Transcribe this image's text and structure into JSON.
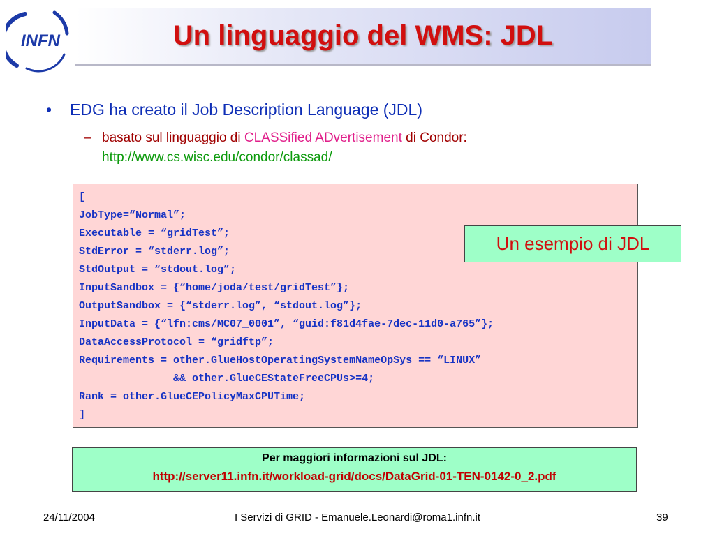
{
  "logo": {
    "text": "INFN"
  },
  "title": "Un linguaggio del WMS: JDL",
  "bullet": {
    "symbol": "•",
    "text": "EDG ha creato il Job Description Language (JDL)"
  },
  "sub_bullet": {
    "symbol": "–",
    "part1": "basato sul linguaggio di ",
    "part2": "CLASSified ADvertisement",
    "part3": " di Condor:",
    "url": "http://www.cs.wisc.edu/condor/classad/"
  },
  "code_lines": [
    "[",
    "JobType=“Normal”;",
    "Executable = “gridTest”;",
    "StdError = “stderr.log”;",
    "StdOutput = “stdout.log”;",
    "InputSandbox = {“home/joda/test/gridTest”};",
    "OutputSandbox = {“stderr.log”, “stdout.log”};",
    "InputData = {“lfn:cms/MC07_0001”, “guid:f81d4fae-7dec-11d0-a765”};",
    "DataAccessProtocol = “gridftp”;",
    "Requirements = other.GlueHostOperatingSystemNameOpSys == “LINUX”",
    "               && other.GlueCEStateFreeCPUs>=4;",
    "Rank = other.GlueCEPolicyMaxCPUTime;",
    "]"
  ],
  "example_label": "Un esempio di JDL",
  "info": {
    "heading": "Per maggiori informazioni sul JDL:",
    "url": "http://server11.infn.it/workload-grid/docs/DataGrid-01-TEN-0142-0_2.pdf"
  },
  "footer": {
    "date": "24/11/2004",
    "center": "I Servizi di GRID - Emanuele.Leonardi@roma1.infn.it",
    "page": "39"
  },
  "colors": {
    "title": "#d10f0f",
    "bullet": "#0f2fb6",
    "code": "#1733c4",
    "code_bg": "#ffd6d6",
    "note_bg": "#9effc8",
    "url_green": "#0b9a0b"
  }
}
